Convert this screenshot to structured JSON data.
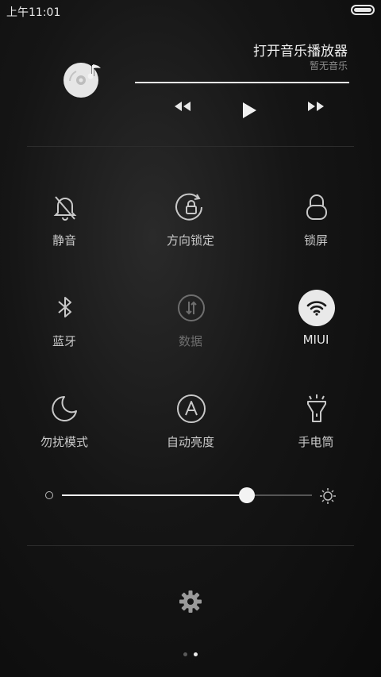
{
  "status_bar": {
    "time": "上午11:01",
    "battery_level": 1.0
  },
  "music": {
    "title": "打开音乐播放器",
    "subtitle": "暂无音乐",
    "progress": 1.0,
    "controls": [
      "previous-icon",
      "play-icon",
      "next-icon"
    ]
  },
  "toggles": [
    {
      "label": "静音",
      "icon": "bell-off-icon",
      "state": "off"
    },
    {
      "label": "方向锁定",
      "icon": "rotation-lock-icon",
      "state": "off"
    },
    {
      "label": "锁屏",
      "icon": "lock-icon",
      "state": "off"
    },
    {
      "label": "蓝牙",
      "icon": "bluetooth-icon",
      "state": "off"
    },
    {
      "label": "数据",
      "icon": "mobile-data-icon",
      "state": "disabled"
    },
    {
      "label": "MIUI",
      "icon": "wifi-icon",
      "state": "on"
    },
    {
      "label": "勿扰模式",
      "icon": "moon-icon",
      "state": "off"
    },
    {
      "label": "自动亮度",
      "icon": "auto-brightness-icon",
      "state": "off"
    },
    {
      "label": "手电筒",
      "icon": "flashlight-icon",
      "state": "off"
    }
  ],
  "brightness": {
    "level": 0.74
  },
  "pager": {
    "pages": 2,
    "current": 2
  },
  "colors": {
    "accent": "#e9e9e9",
    "dim": "#6e6e6e",
    "background": "#121212"
  }
}
